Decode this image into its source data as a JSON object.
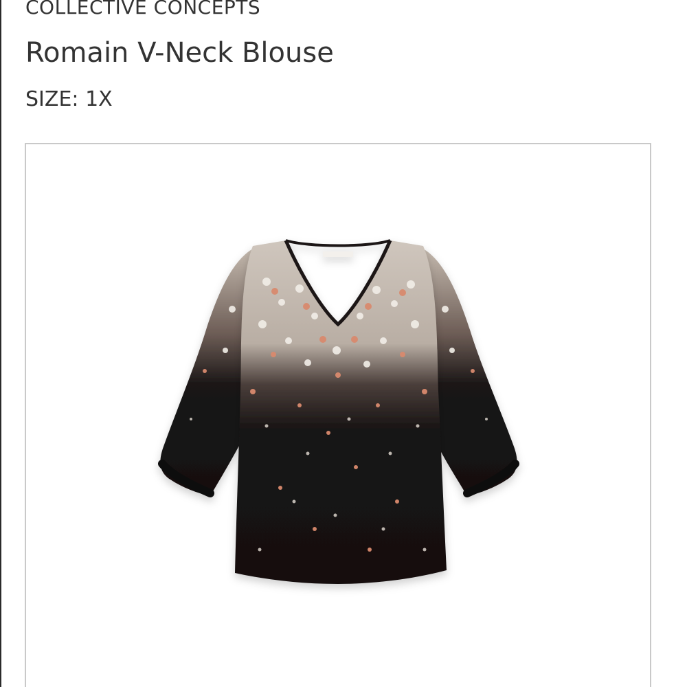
{
  "product": {
    "brand": "COLLECTIVE CONCEPTS",
    "name": "Romain V-Neck Blouse",
    "size_label": "SIZE:",
    "size_value": "1X"
  },
  "image": {
    "subject": "black floral v-neck blouse",
    "colors": {
      "fabric": "#141212",
      "floral_light": "#e6ded6",
      "floral_pink": "#d98a6e",
      "floral_cream": "#f2eee8"
    }
  }
}
